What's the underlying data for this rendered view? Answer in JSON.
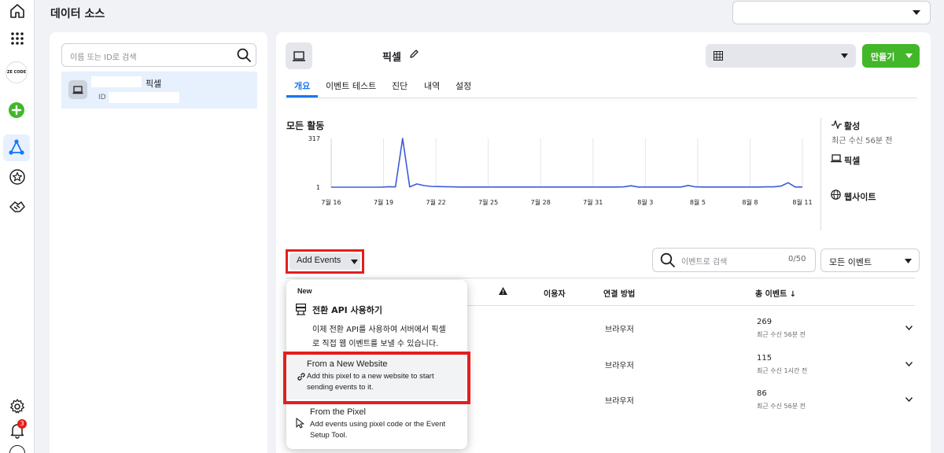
{
  "header": {
    "title": "데이터 소스"
  },
  "left_nav": {
    "logo_text": "ZE CODE",
    "notification_badge": "3"
  },
  "sidebar": {
    "search_placeholder": "이름 또는 ID로 검색",
    "item": {
      "name": "픽셀",
      "id_label": "ID"
    }
  },
  "pixel": {
    "name": "픽셀"
  },
  "toolbar": {
    "create_label": "만들기"
  },
  "tabs": [
    {
      "label": "개요",
      "active": true
    },
    {
      "label": "이벤트 테스트"
    },
    {
      "label": "진단"
    },
    {
      "label": "내역"
    },
    {
      "label": "설정"
    }
  ],
  "activity": {
    "title": "모든 활동"
  },
  "chart_data": {
    "type": "line",
    "x_labels": [
      "7월 16",
      "7월 19",
      "7월 22",
      "7월 25",
      "7월 28",
      "7월 31",
      "8월 3",
      "8월 5",
      "8월 8",
      "8월 11"
    ],
    "yticks": [
      "317",
      "1"
    ],
    "y_range": [
      1,
      317
    ],
    "series": [
      {
        "values": [
          1,
          1,
          1,
          1,
          1,
          1,
          1,
          1,
          4,
          3,
          317,
          3,
          22,
          11,
          6,
          5,
          4,
          3,
          2,
          2,
          2,
          2,
          2,
          2,
          2,
          2,
          2,
          2,
          2,
          2,
          2,
          2,
          2,
          2,
          2,
          2,
          2,
          2,
          2,
          2,
          2,
          3,
          10,
          2,
          2,
          2,
          2,
          2,
          2,
          2,
          12,
          3,
          2,
          2,
          2,
          2,
          2,
          2,
          2,
          2,
          2,
          3,
          3,
          8,
          30,
          2,
          2
        ]
      }
    ],
    "color": "#3b5bdb"
  },
  "status_panel": {
    "active_label": "활성",
    "last_received": "최근 수신 56분 전",
    "pixel_label": "픽셀",
    "website_label": "웹사이트"
  },
  "events": {
    "add_events_label": "Add Events",
    "search_placeholder": "이벤트로 검색",
    "count": "0/50",
    "filter_label": "모든 이벤트",
    "columns": {
      "users": "이용자",
      "connection": "연결 방법",
      "total": "총 이벤트 ↓"
    },
    "rows": [
      {
        "connection": "브라우저",
        "total": "269",
        "received": "최근 수신 56분 전"
      },
      {
        "connection": "브라우저",
        "total": "115",
        "received": "최근 수신 1시간 전"
      },
      {
        "connection": "브라우저",
        "total": "86",
        "received": "최근 수신 56분 전"
      }
    ]
  },
  "menu": {
    "new_badge": "New",
    "conversion_api": {
      "title": "전환 API 사용하기",
      "desc_line1": "이제 전환 API를 사용하여 서버에서 픽셀",
      "desc_line2": "로 직접 웹 이벤트를 보낼 수 있습니다."
    },
    "new_website": {
      "title": "From a New Website",
      "desc_line1": "Add this pixel to a new website to start",
      "desc_line2": "sending events to it."
    },
    "from_pixel": {
      "title": "From the Pixel",
      "desc_line1": "Add events using pixel code or the Event",
      "desc_line2": "Setup Tool."
    }
  },
  "colors": {
    "accent": "#1877f2",
    "create_green": "#42b72a",
    "highlight_red": "#e41e1e",
    "chart_line": "#3b5bdb"
  }
}
